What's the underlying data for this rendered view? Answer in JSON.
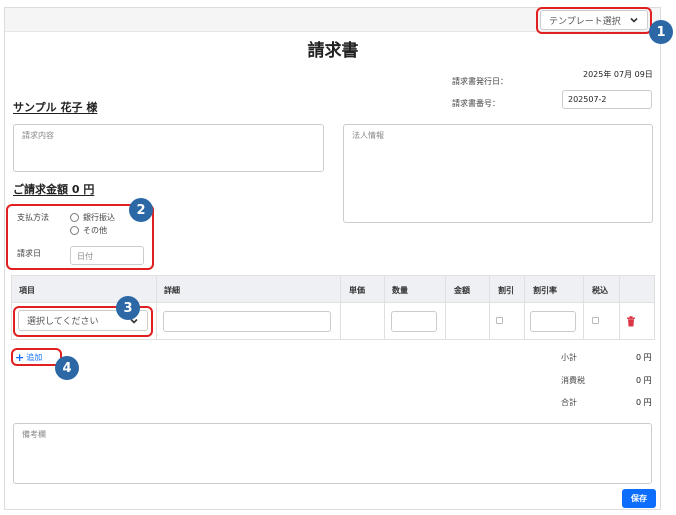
{
  "header": {
    "template_select": "テンプレート選択",
    "title": "請求書"
  },
  "meta": {
    "issue_date_label": "請求書発行日：",
    "issue_date_value": "2025年 07月 09日",
    "invoice_no_label": "請求書番号：",
    "invoice_no_value": "202507-2"
  },
  "client": {
    "name": "サンプル 花子 様",
    "content_placeholder": "請求内容",
    "corporate_placeholder": "法人情報",
    "amount_label": "ご請求金額 0 円"
  },
  "payment": {
    "method_label": "支払方法",
    "options": [
      "銀行振込",
      "その他"
    ],
    "date_label": "請求日",
    "date_placeholder": "日付"
  },
  "table": {
    "headers": [
      "項目",
      "詳細",
      "単価",
      "数量",
      "金額",
      "割引",
      "割引率",
      "税込"
    ],
    "item_select": "選択してください"
  },
  "add_label": "追加",
  "totals": [
    {
      "label": "小計",
      "value": "0 円"
    },
    {
      "label": "消費税",
      "value": "0 円"
    },
    {
      "label": "合計",
      "value": "0 円"
    }
  ],
  "notes_placeholder": "備考欄",
  "save_label": "保存",
  "badges": [
    "1",
    "2",
    "3",
    "4"
  ],
  "colors": {
    "callout": "#e02020",
    "badge": "#2c67a6",
    "primary": "#0d6efd",
    "delete": "#dc3545"
  }
}
